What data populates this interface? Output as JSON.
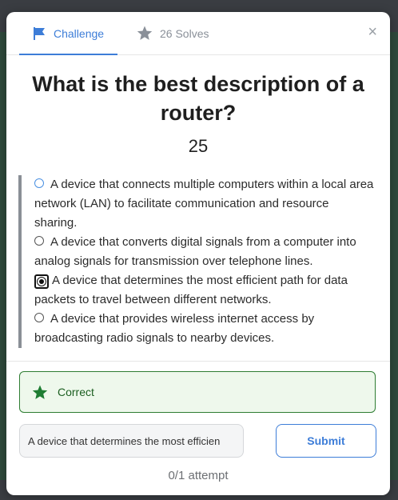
{
  "tabs": {
    "challenge_label": "Challenge",
    "solves_label": "26 Solves",
    "close_glyph": "×"
  },
  "challenge": {
    "title": "What is the best description of a router?",
    "points": "25"
  },
  "options": [
    {
      "label": "A device that connects multiple computers within a local area network (LAN) to facilitate communication and resource sharing.",
      "selected": false
    },
    {
      "label": "A device that converts digital signals from a computer into analog signals for transmission over telephone lines.",
      "selected": false
    },
    {
      "label": "A device that determines the most efficient path for data packets to travel between different networks.",
      "selected": true
    },
    {
      "label": "A device that provides wireless internet access by broadcasting radio signals to nearby devices.",
      "selected": false
    }
  ],
  "result": {
    "message": "Correct",
    "color": "#2e7d32"
  },
  "answer": {
    "value": "A device that determines the most efficien"
  },
  "submit_label": "Submit",
  "attempts_text": "0/1 attempt",
  "colors": {
    "accent": "#3d7dd8",
    "success_bg": "#eef8ec",
    "success_border": "#2e7d32"
  },
  "icons": {
    "challenge_tab": "flag-icon",
    "solves_tab": "star-icon",
    "result": "star-icon"
  }
}
